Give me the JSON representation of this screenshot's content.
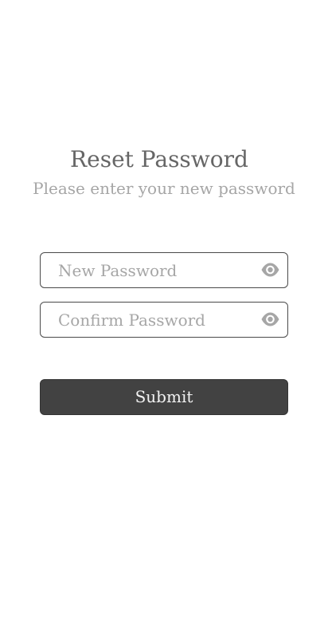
{
  "page": {
    "title": "Reset Password",
    "subtitle": "Please enter your new password"
  },
  "form": {
    "new_password": {
      "value": "",
      "placeholder": "New Password",
      "icon": "eye-icon"
    },
    "confirm_password": {
      "value": "",
      "placeholder": "Confirm Password",
      "icon": "eye-icon"
    },
    "submit_label": "Submit"
  },
  "colors": {
    "title": "#666666",
    "subtitle": "#a6a6a6",
    "button_bg": "#424242",
    "button_text": "#f2f2f2",
    "field_border": "#4a4a4a",
    "icon": "#a6a6a6"
  }
}
